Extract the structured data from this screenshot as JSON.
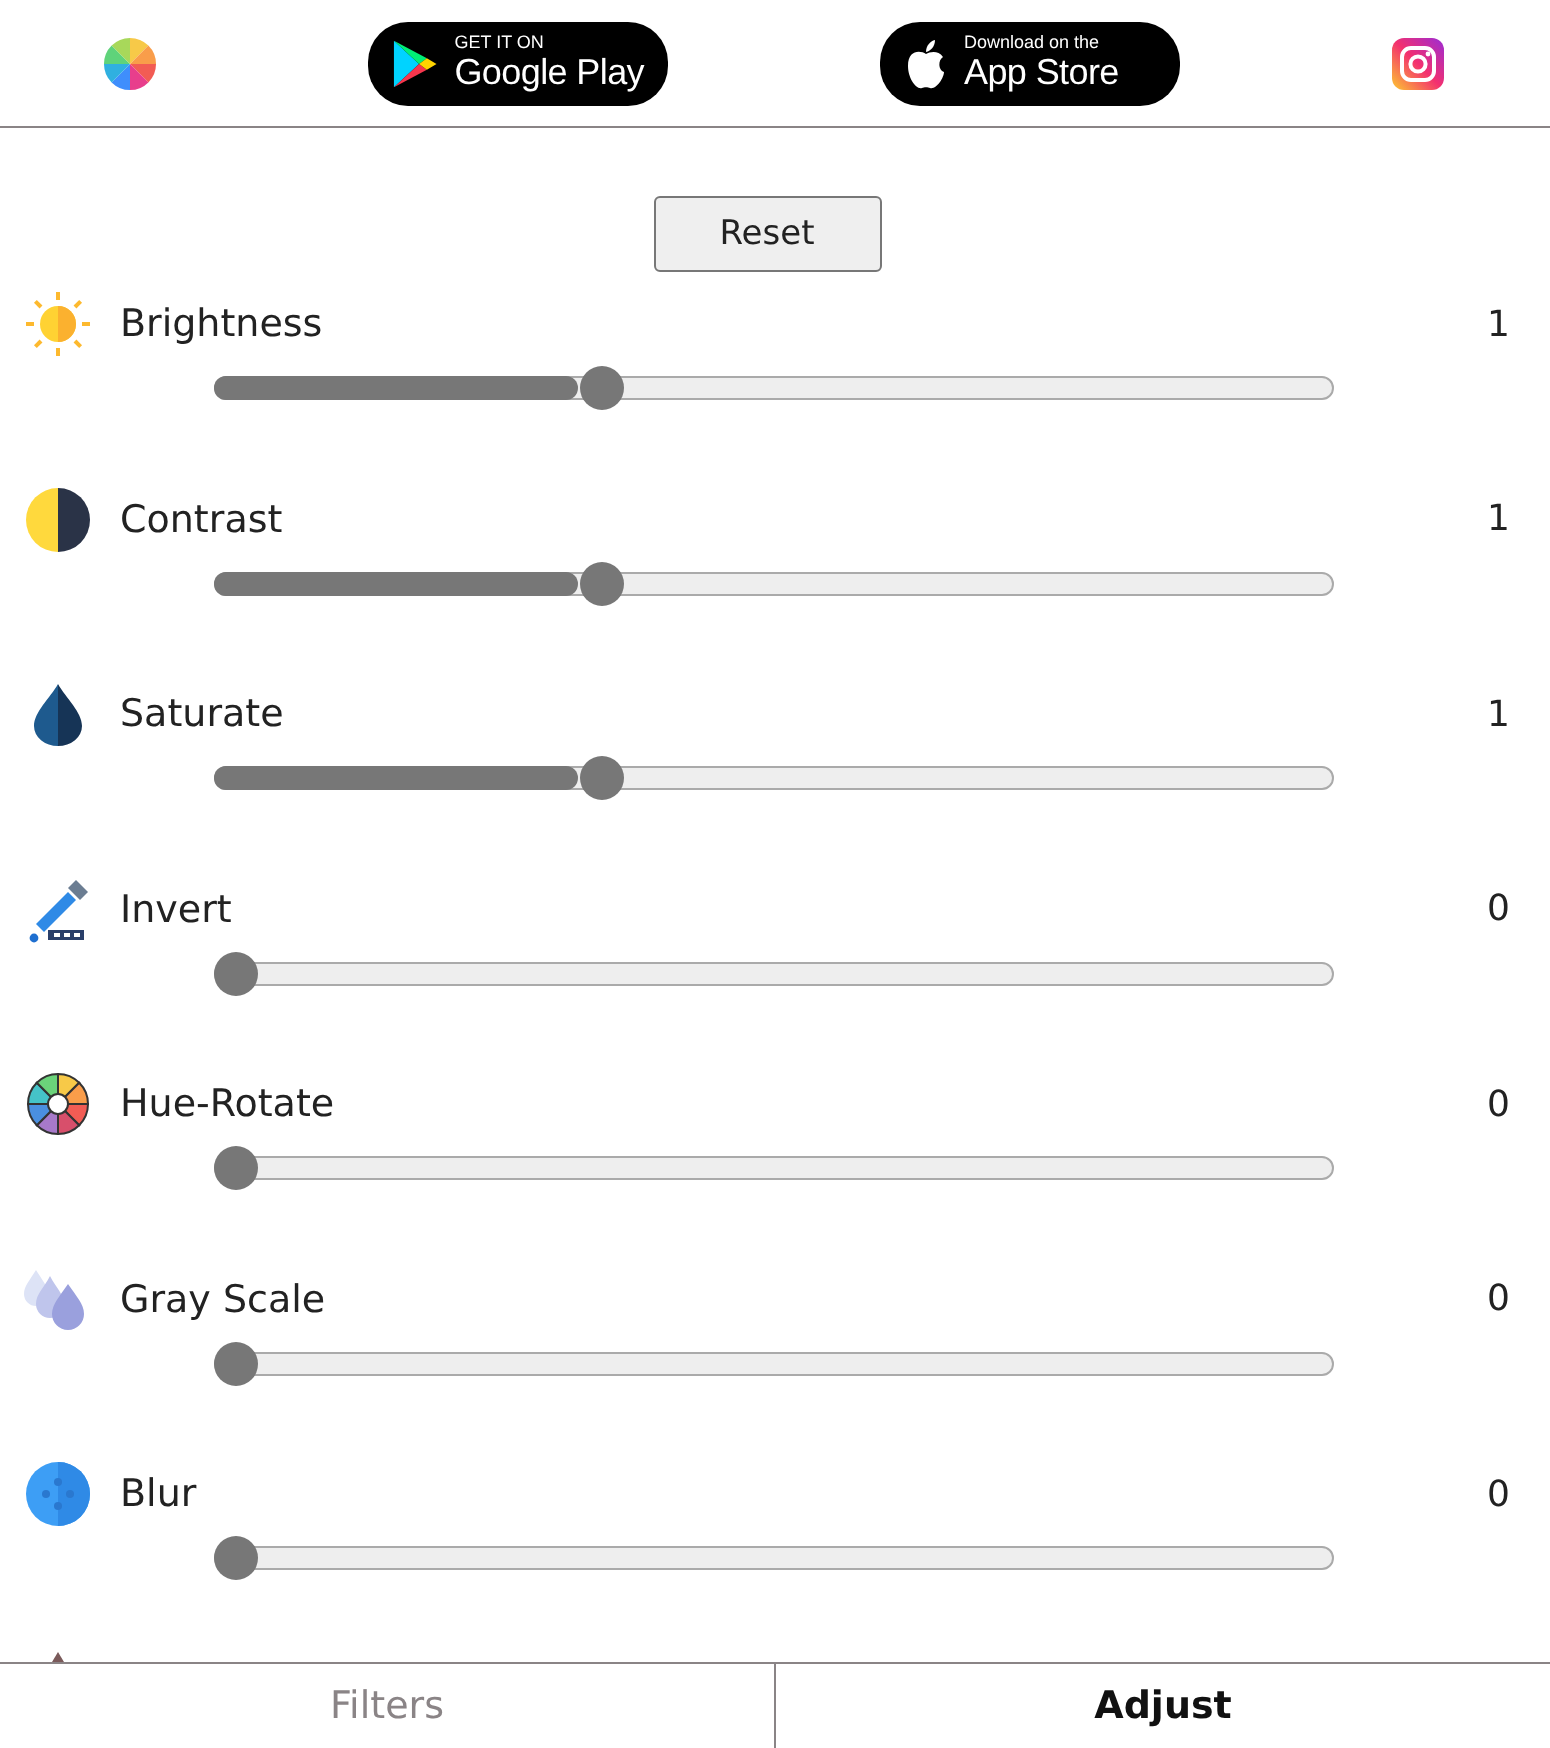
{
  "header": {
    "badges": [
      {
        "kind": "play",
        "small": "GET IT ON",
        "big": "Google Play"
      },
      {
        "kind": "apple",
        "small": "Download on the",
        "big": "App Store"
      }
    ]
  },
  "reset_button": "Reset",
  "adjustments": [
    {
      "kind": "sun",
      "name": "Brightness",
      "value": "1",
      "level": 0.34
    },
    {
      "kind": "contrast",
      "name": "Contrast",
      "value": "1",
      "level": 0.34
    },
    {
      "kind": "drop",
      "name": "Saturate",
      "value": "1",
      "level": 0.34
    },
    {
      "kind": "dropper",
      "name": "Invert",
      "value": "0",
      "level": 0
    },
    {
      "kind": "wheel",
      "name": "Hue-Rotate",
      "value": "0",
      "level": 0
    },
    {
      "kind": "drops",
      "name": "Gray Scale",
      "value": "0",
      "level": 0
    },
    {
      "kind": "blur",
      "name": "Blur",
      "value": "0",
      "level": 0
    }
  ],
  "tabs": [
    {
      "label": "Filters",
      "selected": false
    },
    {
      "label": "Adjust",
      "selected": true
    }
  ]
}
